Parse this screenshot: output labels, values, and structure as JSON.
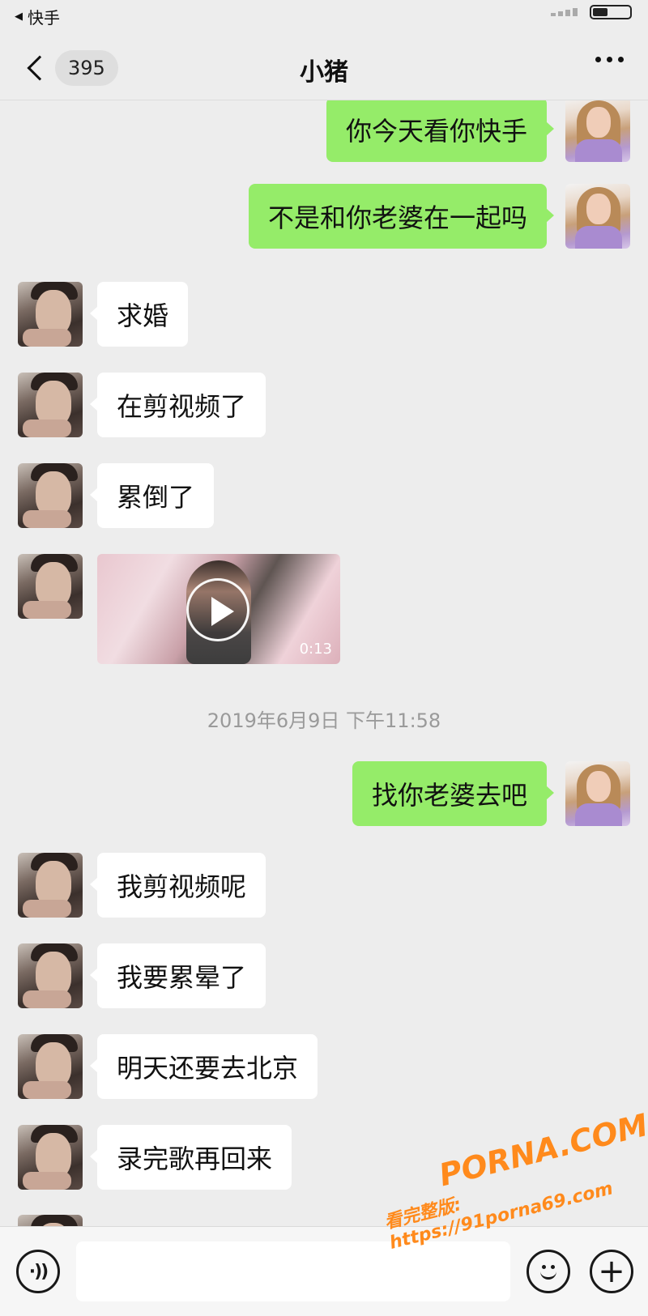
{
  "status_bar": {
    "back_app": "快手"
  },
  "nav": {
    "unread_count": "395",
    "title": "小猪"
  },
  "messages": [
    {
      "side": "out",
      "text": "你今天看你快手"
    },
    {
      "side": "out",
      "text": "不是和你老婆在一起吗"
    },
    {
      "side": "in",
      "text": "求婚"
    },
    {
      "side": "in",
      "text": "在剪视频了"
    },
    {
      "side": "in",
      "text": "累倒了"
    },
    {
      "side": "in",
      "type": "video",
      "duration": "0:13"
    },
    {
      "type": "timestamp",
      "text": "2019年6月9日 下午11:58"
    },
    {
      "side": "out",
      "text": "找你老婆去吧"
    },
    {
      "side": "in",
      "text": "我剪视频呢"
    },
    {
      "side": "in",
      "text": "我要累晕了"
    },
    {
      "side": "in",
      "text": "明天还要去北京"
    },
    {
      "side": "in",
      "text": "录完歌再回来"
    }
  ],
  "input_bar": {
    "placeholder": ""
  },
  "watermark": {
    "main": "PORNA.COM",
    "sub": "看完整版: https://91porna69.com"
  },
  "icons": {
    "back": "chevron-left-icon",
    "more": "more-dots-icon",
    "voice": "voice-icon",
    "emoji": "emoji-icon",
    "plus": "plus-icon",
    "play": "play-icon"
  },
  "colors": {
    "outgoing_bubble": "#95ec69",
    "incoming_bubble": "#ffffff",
    "background": "#ededed",
    "watermark": "#ff8a1c"
  }
}
